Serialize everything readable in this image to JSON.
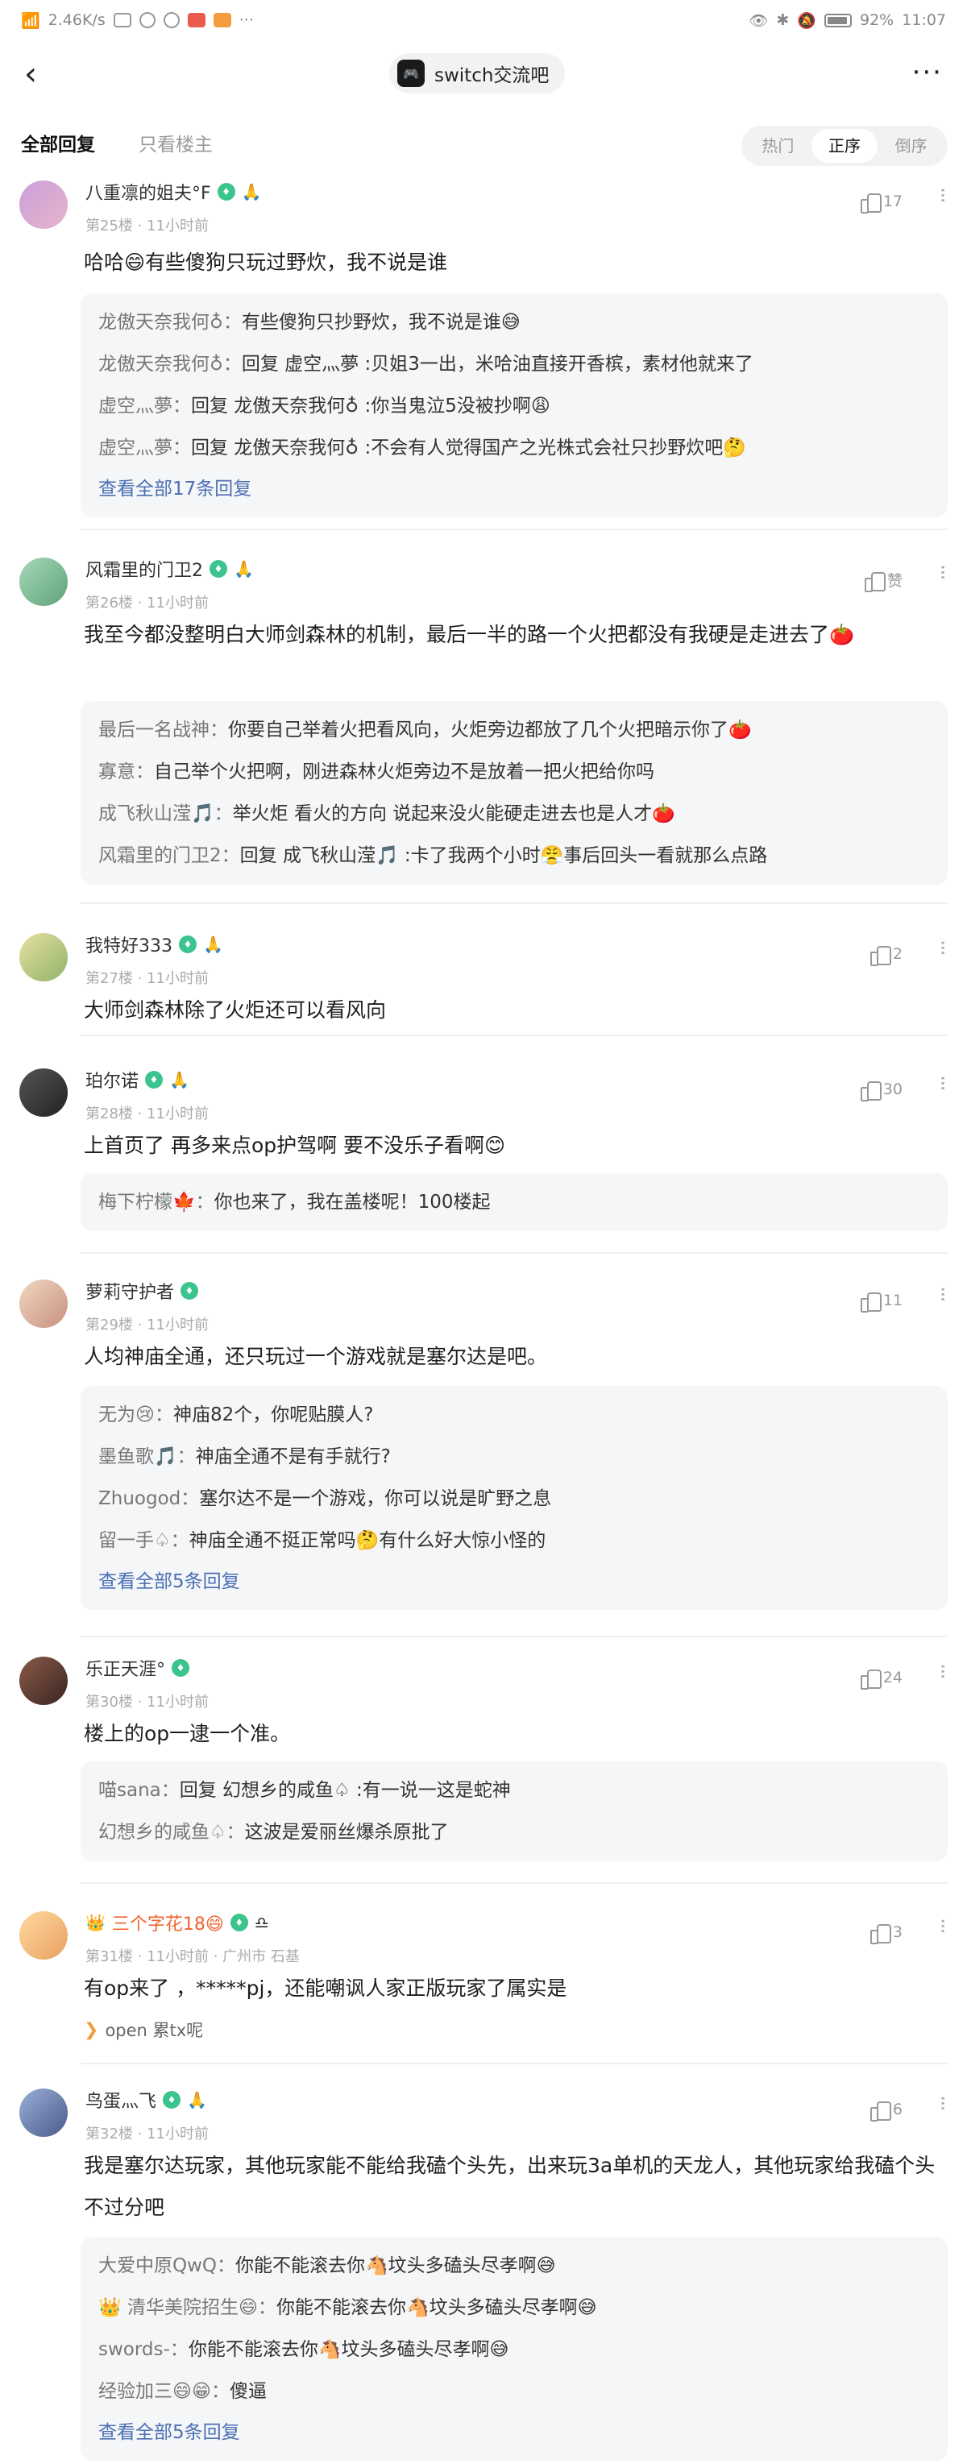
{
  "status_bar": {
    "speed": "2.46K/s",
    "battery": "92%",
    "time": "11:07"
  },
  "header": {
    "forum_name": "switch交流吧",
    "forum_logo_text": "🎮",
    "back_icon": "chevron-left",
    "more_icon": "ellipsis"
  },
  "filter": {
    "all_replies": "全部回复",
    "only_op": "只看楼主",
    "sort": [
      "热门",
      "正序",
      "倒序"
    ],
    "active_sort": "正序"
  },
  "posts": [
    {
      "user": "八重凛的姐夫°F",
      "floor": "第25楼",
      "time": "11小时前",
      "likes": "17",
      "content": "哈哈😄有些傻狗只玩过野炊，我不说是谁",
      "replies": [
        {
          "author": "龙傲天奈我何♁：",
          "text": "有些傻狗只抄野炊，我不说是谁😅"
        },
        {
          "author": "龙傲天奈我何♁：",
          "text": "回复 虚空灬夢 :贝姐3一出，米哈油直接开香槟，素材他就来了"
        },
        {
          "author": "虚空灬夢：",
          "text": "回复 龙傲天奈我何♁ :你当鬼泣5没被抄啊😩"
        },
        {
          "author": "虚空灬夢：",
          "text": "回复 龙傲天奈我何♁ :不会有人觉得国产之光株式会社只抄野炊吧🤔"
        }
      ],
      "see_all": "查看全部17条回复"
    },
    {
      "user": "风霜里的门卫2",
      "floor": "第26楼",
      "time": "11小时前",
      "likes": "赞",
      "content": "我至今都没整明白大师剑森林的机制，最后一半的路一个火把都没有我硬是走进去了🍅",
      "replies": [
        {
          "author": "最后一名战神：",
          "text": "你要自己举着火把看风向，火炬旁边都放了几个火把暗示你了🍅"
        },
        {
          "author": "寡意：",
          "text": "自己举个火把啊，刚进森林火炬旁边不是放着一把火把给你吗"
        },
        {
          "author": "成飞秋山滢🎵：",
          "text": "举火炬 看火的方向 说起来没火能硬走进去也是人才🍅"
        },
        {
          "author": "风霜里的门卫2：",
          "text": "回复 成飞秋山滢🎵 :卡了我两个小时😤事后回头一看就那么点路"
        }
      ],
      "see_all": ""
    },
    {
      "user": "我特好333",
      "floor": "第27楼",
      "time": "11小时前",
      "likes": "2",
      "content": "大师剑森林除了火炬还可以看风向",
      "replies": [],
      "see_all": ""
    },
    {
      "user": "珀尔诺",
      "floor": "第28楼",
      "time": "11小时前",
      "likes": "30",
      "content": "上首页了 再多来点op护驾啊 要不没乐子看啊😊",
      "replies": [
        {
          "author": "梅下柠檬🍁：",
          "text": "你也来了，我在盖楼呢！100楼起"
        }
      ],
      "see_all": ""
    },
    {
      "user": "萝莉守护者",
      "floor": "第29楼",
      "time": "11小时前",
      "likes": "11",
      "content": "人均神庙全通，还只玩过一个游戏就是塞尔达是吧。",
      "replies": [
        {
          "author": "无为😢：",
          "text": "神庙82个，你呢贴膜人?"
        },
        {
          "author": "墨鱼歌🎵：",
          "text": "神庙全通不是有手就行?"
        },
        {
          "author": "Zhuogod：",
          "text": "塞尔达不是一个游戏，你可以说是旷野之息"
        },
        {
          "author": "留一手♤：",
          "text": "神庙全通不挺正常吗🤔有什么好大惊小怪的"
        }
      ],
      "see_all": "查看全部5条回复"
    },
    {
      "user": "乐正天涯°",
      "floor": "第30楼",
      "time": "11小时前",
      "likes": "24",
      "content": "楼上的op一逮一个准。",
      "replies": [
        {
          "author": "喵sana：",
          "text": "回复 幻想乡的咸鱼♤ :有一说一这是蛇神"
        },
        {
          "author": "幻想乡的咸鱼♤：",
          "text": "这波是爱丽丝爆杀原批了"
        }
      ],
      "see_all": ""
    },
    {
      "user": "三个字花18😄",
      "floor": "第31楼",
      "time": "11小时前",
      "location": "广州市 石基",
      "likes": "3",
      "content": "有op来了 ，*****pj，还能嘲讽人家正版玩家了属实是",
      "tail": "open 累tx呢",
      "replies": [],
      "see_all": ""
    },
    {
      "user": "鸟蛋灬飞",
      "floor": "第32楼",
      "time": "11小时前",
      "likes": "6",
      "content": "我是塞尔达玩家，其他玩家能不能给我磕个头先，出来玩3a单机的天龙人，其他玩家给我磕个头不过分吧",
      "replies": [
        {
          "author": "大爱中原QwQ：",
          "text": "你能不能滚去你🐴坟头多磕头尽孝啊😅"
        },
        {
          "author": "👑 清华美院招生😄：",
          "text": "你能不能滚去你🐴坟头多磕头尽孝啊😅"
        },
        {
          "author": "swords-：",
          "text": "你能不能滚去你🐴坟头多磕头尽孝啊😅"
        },
        {
          "author": "经验加三😄😁：",
          "text": "傻逼"
        }
      ],
      "see_all": "查看全部5条回复"
    }
  ],
  "colors": {
    "link": "#4a6fb5",
    "vip_name": "#f0652f",
    "level_badge": "#3cc48e"
  }
}
